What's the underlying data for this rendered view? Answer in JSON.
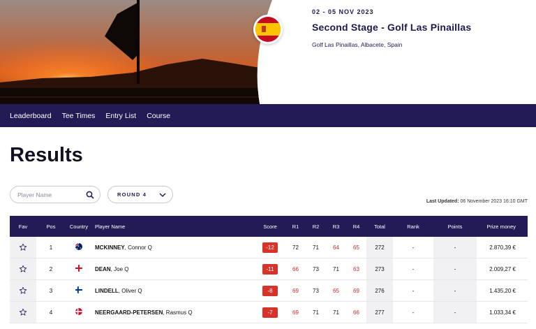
{
  "event": {
    "date": "02 - 05 NOV 2023",
    "title": "Second Stage - Golf Las Pinaillas",
    "venue": "Golf Las Pinaillas, Albacete, Spain",
    "country_flag": "spain-flag"
  },
  "nav": {
    "items": [
      "Leaderboard",
      "Tee Times",
      "Entry List",
      "Course"
    ]
  },
  "page": {
    "title": "Results"
  },
  "filters": {
    "search_placeholder": "Player Name",
    "round_label": "ROUND 4"
  },
  "last_updated": {
    "label": "Last Updated:",
    "value": "06 November 2023 16:10 GMT"
  },
  "table": {
    "headers": {
      "fav": "Fav",
      "pos": "Pos",
      "country": "Country",
      "name": "Player Name",
      "score": "Score",
      "r1": "R1",
      "r2": "R2",
      "r3": "R3",
      "r4": "R4",
      "total": "Total",
      "rank": "Rank",
      "points": "Points",
      "prize": "Prize money"
    },
    "rows": [
      {
        "pos": "1",
        "country": "australia-flag",
        "last": "MCKINNEY",
        "first": ", Connor Q",
        "score": "-12",
        "r1": "72",
        "r2": "71",
        "r3": "64",
        "r4": "65",
        "total": "272",
        "rank": "-",
        "points": "-",
        "prize": "2.870,39 €"
      },
      {
        "pos": "2",
        "country": "england-flag",
        "last": "DEAN",
        "first": ", Joe Q",
        "score": "-11",
        "r1": "66",
        "r2": "73",
        "r3": "71",
        "r4": "63",
        "total": "273",
        "rank": "-",
        "points": "-",
        "prize": "2.009,27 €"
      },
      {
        "pos": "3",
        "country": "finland-flag",
        "last": "LINDELL",
        "first": ", Oliver Q",
        "score": "-8",
        "r1": "69",
        "r2": "73",
        "r3": "65",
        "r4": "69",
        "total": "276",
        "rank": "-",
        "points": "-",
        "prize": "1.435,20 €"
      },
      {
        "pos": "4",
        "country": "denmark-flag",
        "last": "NEERGAARD-PETERSEN",
        "first": ", Rasmus Q",
        "score": "-7",
        "r1": "69",
        "r2": "71",
        "r3": "71",
        "r4": "66",
        "total": "277",
        "rank": "-",
        "points": "-",
        "prize": "1.033,34 €"
      }
    ],
    "under_par_rounds": [
      {
        "r1": false,
        "r2": false,
        "r3": true,
        "r4": true
      },
      {
        "r1": true,
        "r2": false,
        "r3": false,
        "r4": true
      },
      {
        "r1": true,
        "r2": false,
        "r3": true,
        "r4": true
      },
      {
        "r1": true,
        "r2": false,
        "r3": false,
        "r4": true
      }
    ]
  },
  "colors": {
    "navy": "#231b55",
    "score_red": "#d6332b",
    "under_par_text": "#cc2b2b"
  }
}
